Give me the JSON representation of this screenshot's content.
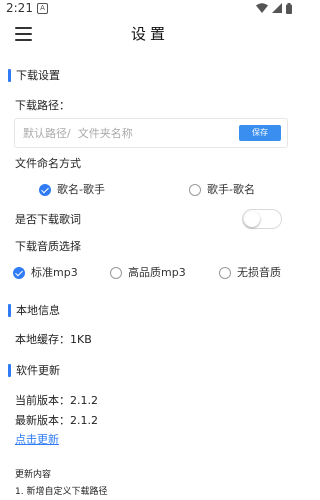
{
  "status_bar": {
    "time": "2:21",
    "app_icon_letter": "A",
    "icons": [
      "wifi-icon",
      "signal-icon",
      "battery-icon"
    ]
  },
  "header": {
    "title": "设置",
    "menu_icon": "menu-icon"
  },
  "download": {
    "section_title": "下载设置",
    "path_label": "下载路径：",
    "path_value": "",
    "path_placeholder": "默认路径/  文件夹名称",
    "save_label": "保存",
    "naming_label": "文件命名方式",
    "naming_options": [
      {
        "label": "歌名-歌手",
        "selected": true
      },
      {
        "label": "歌手-歌名",
        "selected": false
      }
    ],
    "lyrics_label": "是否下载歌词",
    "lyrics_enabled": false,
    "quality_label": "下载音质选择",
    "quality_options": [
      {
        "label": "标准mp3",
        "selected": true
      },
      {
        "label": "高品质mp3",
        "selected": false
      },
      {
        "label": "无损音质",
        "selected": false
      }
    ]
  },
  "local": {
    "section_title": "本地信息",
    "cache_label": "本地缓存：",
    "cache_value": "1KB"
  },
  "update": {
    "section_title": "软件更新",
    "current_label": "当前版本：",
    "current_version": "2.1.2",
    "latest_label": "最新版本：",
    "latest_version": "2.1.2",
    "update_link": "点击更新",
    "changelog_title": "更新内容",
    "changelog_items": [
      "1. 新增自定义下载路径"
    ]
  },
  "colors": {
    "accent": "#2f7cf6",
    "save_button": "#3a8ef0",
    "text": "#222222",
    "placeholder": "#aaaaaa"
  }
}
